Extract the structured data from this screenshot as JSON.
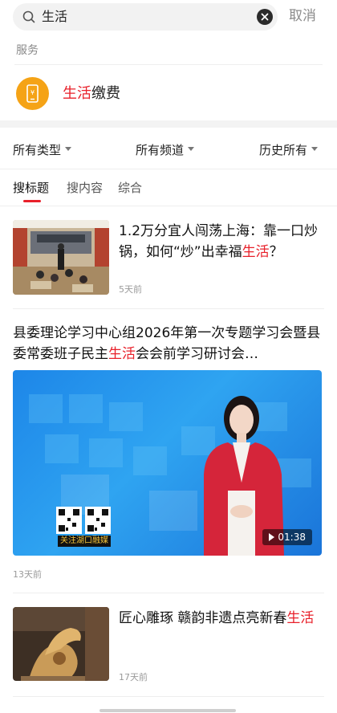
{
  "search": {
    "query": "生活",
    "cancel_label": "取消"
  },
  "service": {
    "section_label": "服务",
    "title_highlight": "生活",
    "title_rest": "缴费"
  },
  "filters": [
    "所有类型",
    "所有频道",
    "历史所有"
  ],
  "tabs": [
    "搜标题",
    "搜内容",
    "综合"
  ],
  "articles": [
    {
      "title_before": "1.2万分宜人闯荡上海：靠一口炒锅，如何“炒”出幸福",
      "title_highlight": "生活",
      "title_after": "？",
      "time": "5天前"
    },
    {
      "title_before": "县委理论学习中心组2026年第一次专题学习会暨县委常委班子民主",
      "title_highlight": "生活",
      "title_after": "会会前学习研讨会…",
      "time": "13天前",
      "duration": "01:38",
      "qr_caption": "关注湖口融媒"
    },
    {
      "title_before": "匠心雕琢 赣韵非遗点亮新春",
      "title_highlight": "生活",
      "title_after": "",
      "time": "17天前"
    }
  ],
  "colors": {
    "highlight": "#e8202a",
    "service_icon": "#f5a316",
    "video_bg": "#1d86e8"
  }
}
